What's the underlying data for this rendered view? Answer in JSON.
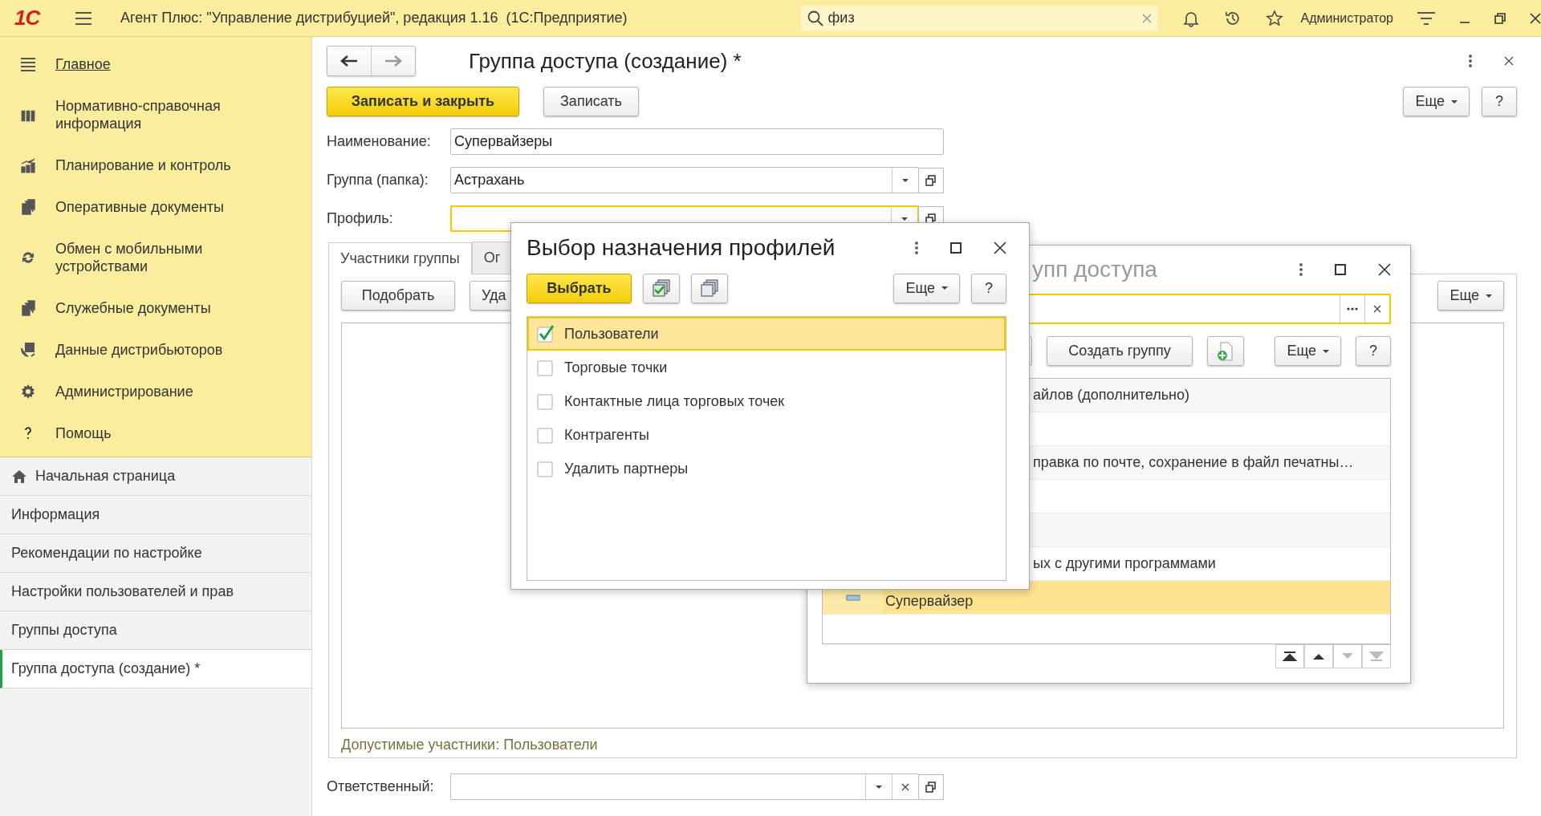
{
  "app_bar": {
    "logo": "1С",
    "title": "Агент Плюс: \"Управление дистрибуцией\", редакция 1.16  (1С:Предприятие)",
    "search": {
      "value": "физ"
    },
    "user": "Администратор"
  },
  "sections": [
    {
      "label": "Главное",
      "selected": true
    },
    {
      "label": "Нормативно-справочная информация",
      "selected": false
    },
    {
      "label": "Планирование и контроль",
      "selected": false
    },
    {
      "label": "Оперативные документы",
      "selected": false
    },
    {
      "label": "Обмен с мобильными устройствами",
      "selected": false
    },
    {
      "label": "Служебные документы",
      "selected": false
    },
    {
      "label": "Данные дистрибьюторов",
      "selected": false
    },
    {
      "label": "Администрирование",
      "selected": false
    },
    {
      "label": "Помощь",
      "selected": false
    }
  ],
  "open_windows": [
    {
      "label": "Начальная страница",
      "kind": "home",
      "selected": false
    },
    {
      "label": "Информация",
      "kind": "page",
      "selected": false
    },
    {
      "label": "Рекомендации по настройке",
      "kind": "page",
      "selected": false
    },
    {
      "label": "Настройки пользователей и прав",
      "kind": "page",
      "selected": false
    },
    {
      "label": "Группы доступа",
      "kind": "page",
      "selected": false
    },
    {
      "label": "Группа доступа (создание) *",
      "kind": "page",
      "selected": true
    }
  ],
  "form": {
    "title": "Группа доступа (создание) *",
    "buttons": [
      {
        "label": "Записать и закрыть",
        "kind": "primary"
      },
      {
        "label": "Записать",
        "kind": "normal"
      }
    ],
    "more": "Еще",
    "help": "?",
    "fields": [
      {
        "label": "Наименование:",
        "value": "Супервайзеры",
        "kind": "text",
        "focused": false
      },
      {
        "label": "Группа (папка):",
        "value": "Астрахань",
        "kind": "choice",
        "focused": false
      },
      {
        "label": "Профиль:",
        "kind": "choice",
        "focused": true
      }
    ],
    "tabs": [
      {
        "label": "Участники группы",
        "selected": true
      },
      {
        "label": "Ог",
        "selected": false
      }
    ],
    "tab_buttons": [
      "Подобрать",
      "Уда"
    ],
    "tab_more": "Еще",
    "note": "Допустимые участники: Пользователи",
    "responsible": {
      "label": "Ответственный:"
    }
  },
  "groups_dialog": {
    "title": "упп доступа",
    "buttons": [
      "Создать группу"
    ],
    "more": "Еще",
    "help": "?",
    "rows": [
      {
        "text": "айлов (дополнительно)",
        "kind": "cut",
        "selected": false
      },
      {
        "kind": "cut",
        "selected": false
      },
      {
        "text": "правка по почте, сохранение в файл печатны…",
        "kind": "cut",
        "selected": false
      },
      {
        "kind": "cut",
        "selected": false
      },
      {
        "kind": "cut",
        "selected": false
      },
      {
        "text": "ых с другими программами",
        "kind": "cut",
        "selected": false
      },
      {
        "text": "Супервайзер",
        "kind": "item",
        "selected": true
      }
    ]
  },
  "purpose_dialog": {
    "title": "Выбор назначения профилей",
    "primary": "Выбрать",
    "more": "Еще",
    "help": "?",
    "items": [
      {
        "label": "Пользователи",
        "checked": true,
        "selected": true
      },
      {
        "label": "Торговые точки",
        "checked": false,
        "selected": false
      },
      {
        "label": "Контактные лица торговых точек",
        "checked": false,
        "selected": false
      },
      {
        "label": "Контрагенты",
        "checked": false,
        "selected": false
      },
      {
        "label": "Удалить партнеры",
        "checked": false,
        "selected": false
      }
    ]
  }
}
